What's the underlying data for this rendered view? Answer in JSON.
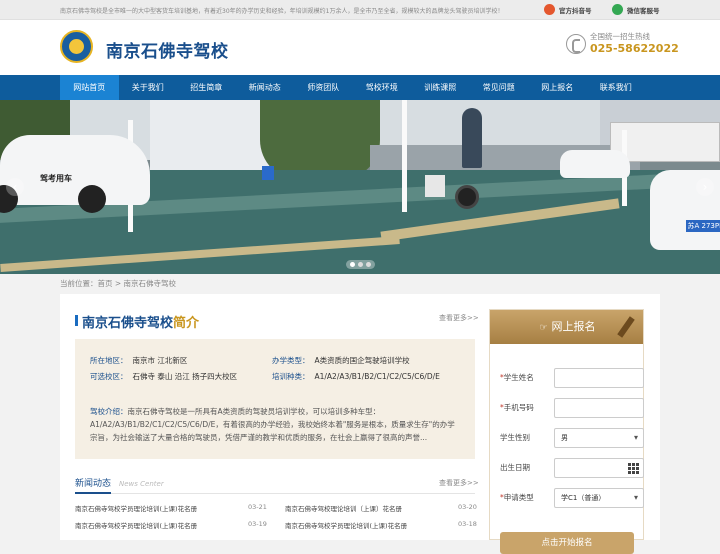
{
  "topbar": {
    "notice": "南京石佛寺驾校是全市唯一的大中型客货车培训基地，有着近30年的办学历史和经验，年培训规模约1万余人，是全市乃至全省，规模较大的品牌龙头驾驶员培训学校！",
    "douyin_label": "官方抖音号",
    "wechat_label": "微信客服号"
  },
  "header": {
    "site_name": "南京石佛寺驾校",
    "hotline_label": "全国统一招生热线",
    "hotline_number": "025-58622022"
  },
  "nav": {
    "items": [
      "网站首页",
      "关于我们",
      "招生简章",
      "新闻动态",
      "师资团队",
      "驾校环境",
      "训练课照",
      "常见问题",
      "网上报名",
      "联系我们"
    ]
  },
  "banner": {
    "car_text": "驾考用车",
    "plate": "苏A 273PD"
  },
  "breadcrumb": {
    "text": "当前位置：首页 > 南京石佛寺驾校"
  },
  "intro": {
    "title_a": "南京石佛寺驾校",
    "title_b": "简介",
    "more": "查看更多>>",
    "area_k": "所在地区：",
    "area_v": "南京市 江北新区",
    "type_k": "办学类型：",
    "type_v": "A类资质的国企驾驶培训学校",
    "sites_k": "可选校区：",
    "sites_v": "石佛寺 泰山 沿江 扬子四大校区",
    "kinds_k": "培训种类：",
    "kinds_v": "A1/A2/A3/B1/B2/C1/C2/C5/C6/D/E",
    "desc_k": "驾校介绍：",
    "desc_v": "南京石佛寺驾校是一所具有A类资质的驾驶员培训学校，可以培训多种车型：A1/A2/A3/B1/B2/C1/C2/C5/C6/D/E，有着很高的办学经验，我校始终本着\"服务是根本，质量求生存\"的办学宗旨，为社会输送了大量合格的驾驶员，凭借严谨的教学和优质的服务，在社会上赢得了很高的声誉..."
  },
  "news": {
    "tab_cn": "新闻动态",
    "tab_en": "News Center",
    "more": "查看更多>>",
    "items": [
      {
        "title": "南京石佛寺驾校学员理论培训(上课)花名册",
        "date": "03-21"
      },
      {
        "title": "南京石佛寺驾校理论培训（上课）花名册",
        "date": "03-20"
      },
      {
        "title": "南京石佛寺驾校学员理论培训(上课)花名册",
        "date": "03-19"
      },
      {
        "title": "南京石佛寺驾校学员理论培训(上课)花名册",
        "date": "03-18"
      }
    ]
  },
  "signup": {
    "title": "网上报名",
    "name_label": "学生姓名",
    "phone_label": "手机号码",
    "gender_label": "学生性别",
    "gender_value": "男",
    "birth_label": "出生日期",
    "type_label": "申请类型",
    "type_value": "学C1（普通）",
    "submit_label": "点击开始报名"
  }
}
